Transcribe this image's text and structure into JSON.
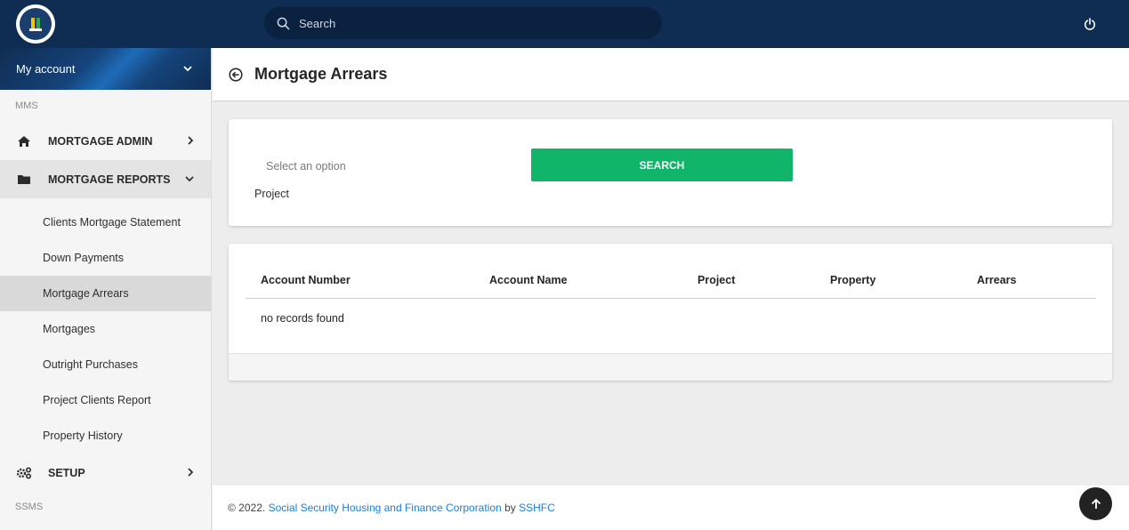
{
  "header": {
    "search_placeholder": "Search"
  },
  "sidebar": {
    "account_label": "My account",
    "section_top": "MMS",
    "items": [
      {
        "label": "MORTGAGE ADMIN",
        "icon": "home-icon"
      },
      {
        "label": "MORTGAGE REPORTS",
        "icon": "folder-icon"
      },
      {
        "label": "SETUP",
        "icon": "gears-icon"
      }
    ],
    "reports_sub": [
      "Clients Mortgage Statement",
      "Down Payments",
      "Mortgage Arrears",
      "Mortgages",
      "Outright Purchases",
      "Project Clients Report",
      "Property History"
    ],
    "active_sub": "Mortgage Arrears",
    "section_bottom": "SSMS"
  },
  "page": {
    "title": "Mortgage Arrears"
  },
  "filter": {
    "select_placeholder": "Select an option",
    "select_label": "Project",
    "search_button": "SEARCH"
  },
  "table": {
    "columns": [
      "Account Number",
      "Account Name",
      "Project",
      "Property",
      "Arrears"
    ],
    "rows": [],
    "empty_message": "no records found"
  },
  "footer": {
    "copyright": "© 2022.",
    "org_link": "Social Security Housing and Finance Corporation",
    "by": "by",
    "author_link": "SSHFC"
  },
  "colors": {
    "topbar": "#0f2d52",
    "accent_green": "#10b569",
    "link": "#1a7fd6"
  }
}
